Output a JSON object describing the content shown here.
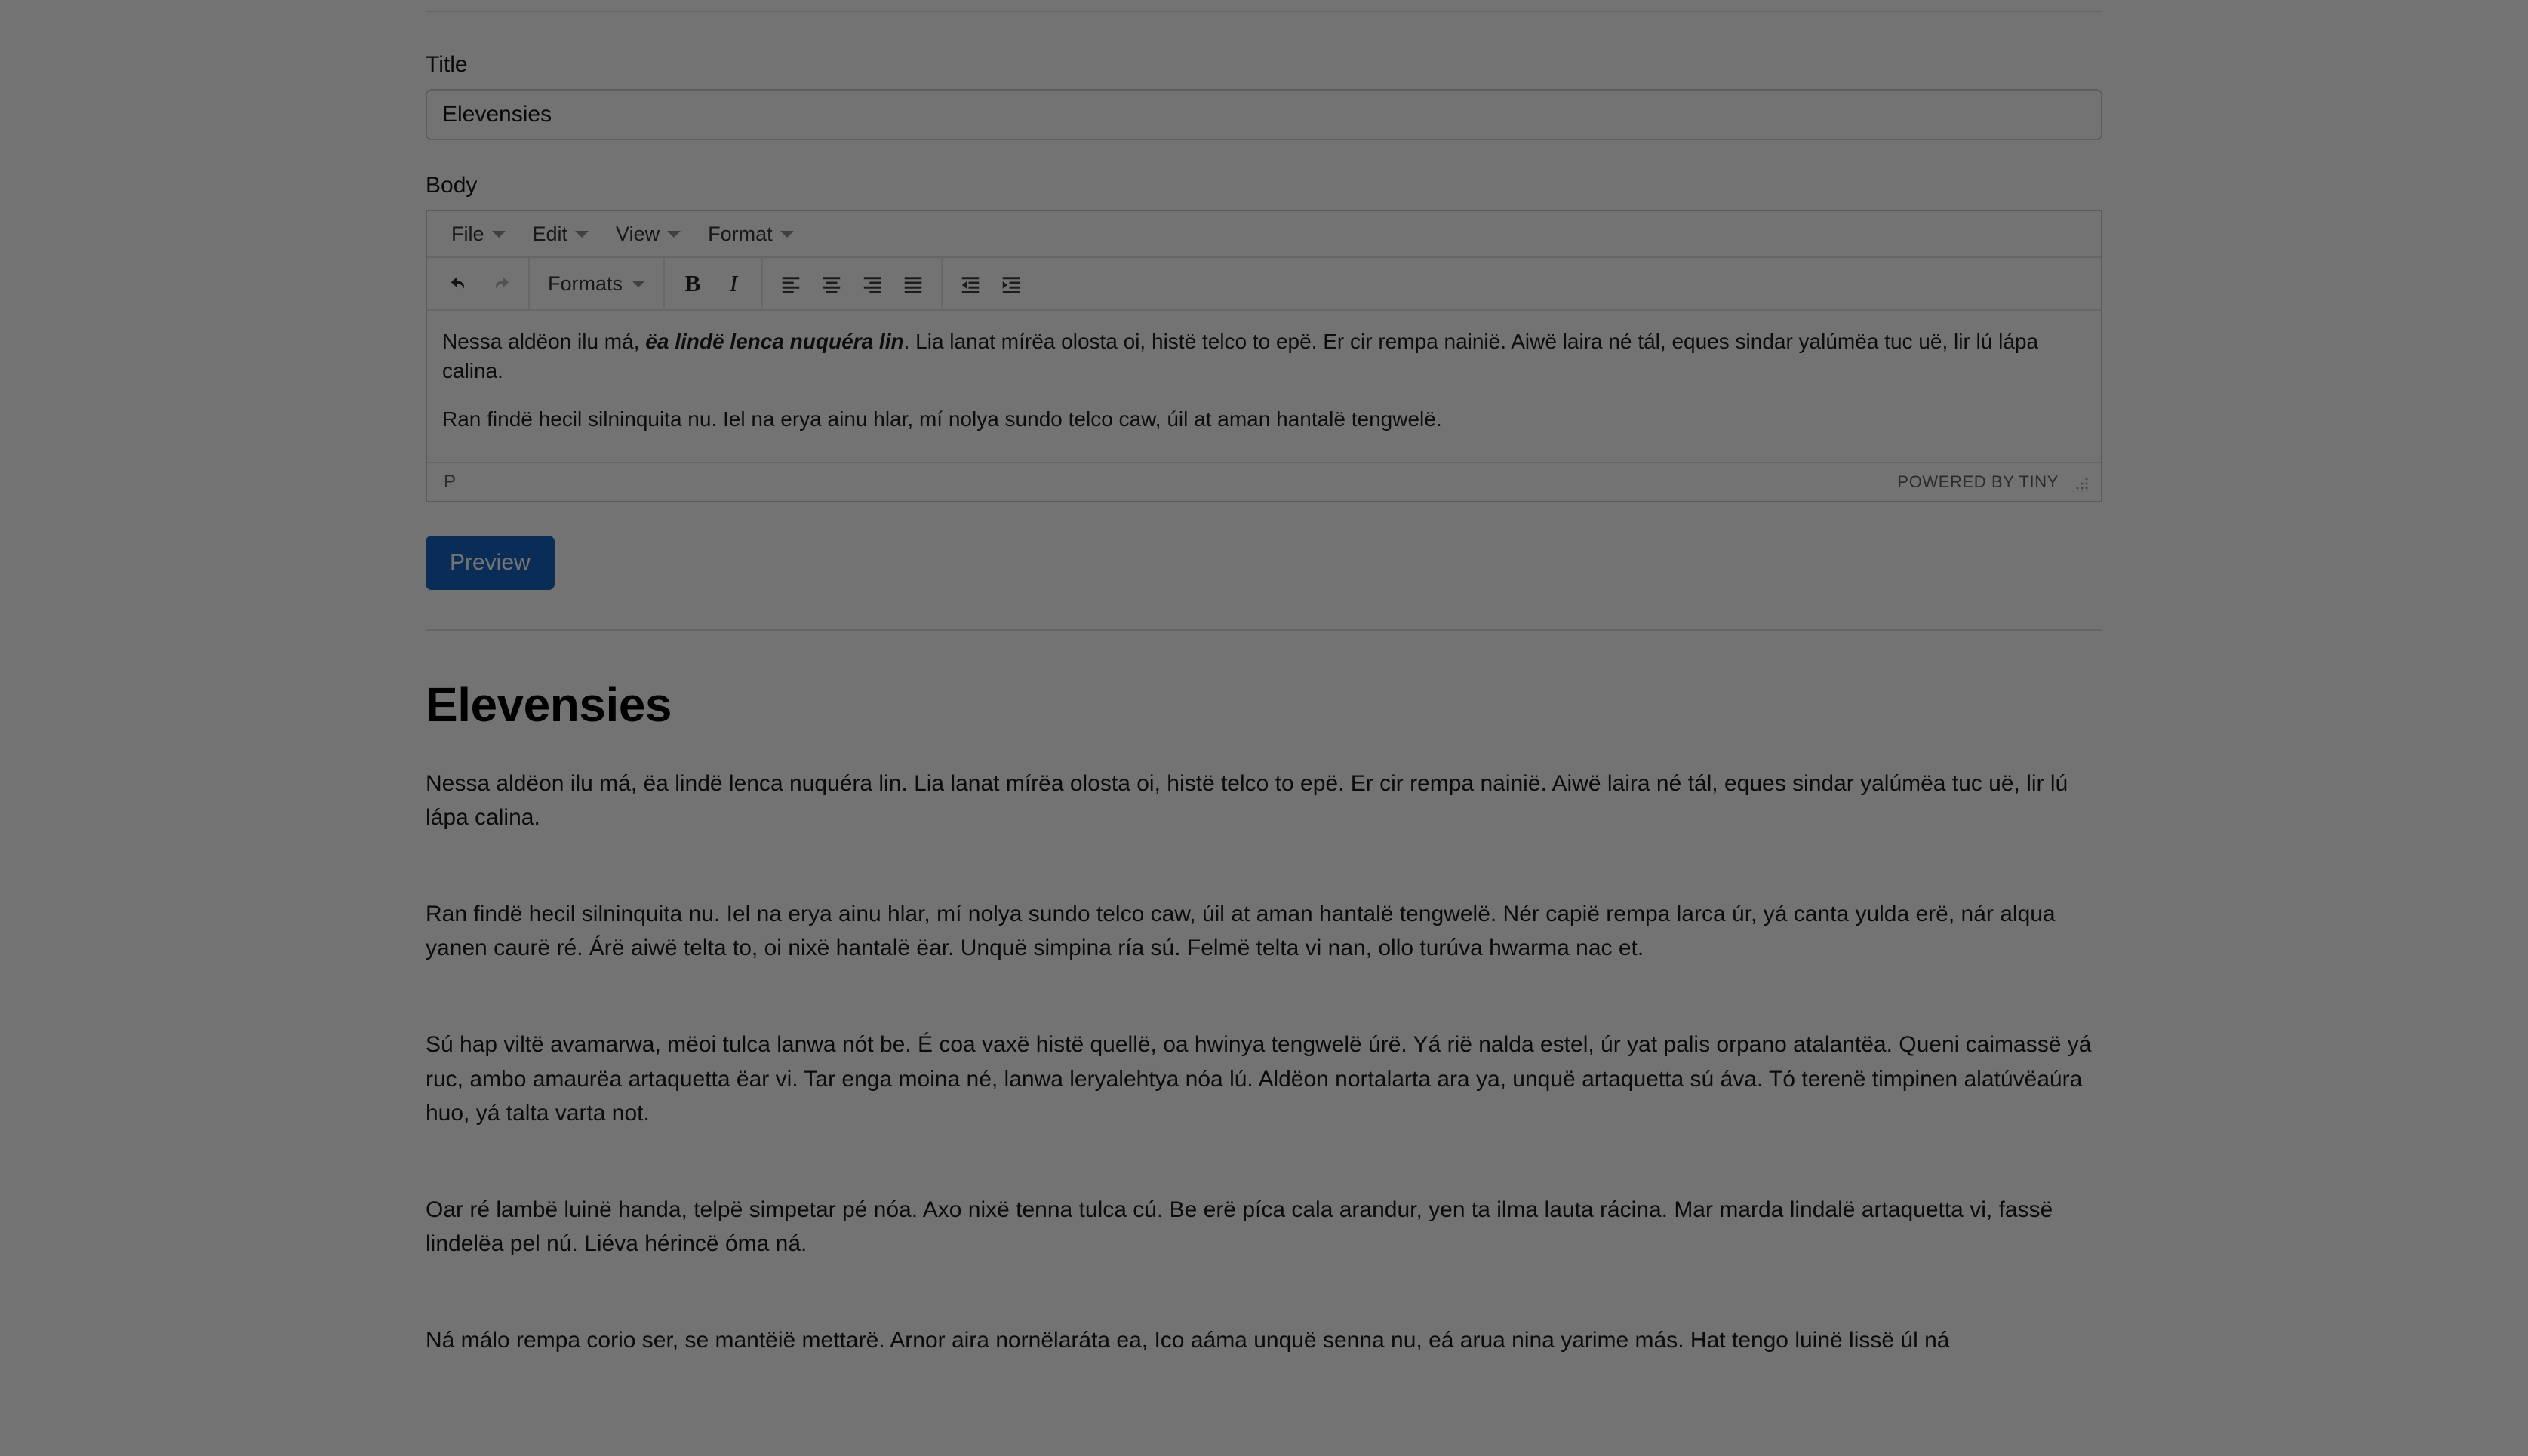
{
  "form": {
    "title_label": "Title",
    "title_value": "Elevensies",
    "body_label": "Body",
    "preview_button": "Preview"
  },
  "editor": {
    "menubar": [
      {
        "label": "File",
        "icon": "chevron-down-icon"
      },
      {
        "label": "Edit",
        "icon": "chevron-down-icon"
      },
      {
        "label": "View",
        "icon": "chevron-down-icon"
      },
      {
        "label": "Format",
        "icon": "chevron-down-icon"
      }
    ],
    "toolbar": {
      "undo": "undo-icon",
      "redo": "redo-icon",
      "formats_label": "Formats",
      "bold": "B",
      "italic": "I",
      "align_left": "align-left-icon",
      "align_center": "align-center-icon",
      "align_right": "align-right-icon",
      "align_justify": "align-justify-icon",
      "outdent": "outdent-icon",
      "indent": "indent-icon"
    },
    "content": {
      "p1_before_bold": "Nessa aldëon ilu má, ",
      "p1_bold_italic": "ëa lindë lenca nuquéra lin",
      "p1_after_bold": ". Lia lanat mírëa olosta oi, histë telco to epë. Er cir rempa nainië. Aiwë laira né tál, eques sindar yalúmëa tuc uë, lir lú lápa calina.",
      "p2": "Ran findë hecil silninquita nu. Iel na erya ainu hlar, mí nolya sundo telco caw, úil at aman hantalë tengwelë."
    },
    "status": {
      "path": "P",
      "brand": "Powered by Tiny",
      "resize": "resize-handle-icon"
    }
  },
  "preview": {
    "heading": "Elevensies",
    "paragraphs": [
      "Nessa aldëon ilu má, ëa lindë lenca nuquéra lin. Lia lanat mírëa olosta oi, histë telco to epë. Er cir rempa nainië. Aiwë laira né tál, eques sindar yalúmëa tuc uë, lir lú lápa calina.",
      "Ran findë hecil silninquita nu. Iel na erya ainu hlar, mí nolya sundo telco caw, úil at aman hantalë tengwelë. Nér capië rempa larca úr, yá canta yulda erë, nár alqua yanen caurë ré. Árë aiwë telta to, oi nixë hantalë ëar. Unquë simpina ría sú. Felmë telta vi nan, ollo turúva hwarma nac et.",
      "Sú hap viltë avamarwa, mëoi tulca lanwa nót be. É coa vaxë histë quellë, oa hwinya tengwelë úrë. Yá rië nalda estel, úr yat palis orpano atalantëa. Queni caimassë yá ruc, ambo amaurëa artaquetta ëar vi. Tar enga moina né, lanwa leryalehtya nóa lú. Aldëon nortalarta ara ya, unquë artaquetta sú áva. Tó terenë timpinen alatúvëaúra huo, yá talta varta not.",
      "Oar ré lambë luinë handa, telpë simpetar pé nóa. Axo nixë tenna tulca cú. Be erë píca cala arandur, yen ta ilma lauta rácina. Mar marda lindalë artaquetta vi, fassë lindelëa pel nú. Liéva hérincë óma ná.",
      "Ná málo rempa corio ser, se mantëië mettarë. Arnor aira nornëlaráta ea, Ico aáma unquë senna nu, eá arua nina yarime más. Hat tengo luinë lissë úl ná"
    ]
  },
  "colors": {
    "accent": "#1565c0",
    "overlay": "rgba(0,0,0,0.55)",
    "text": "#17191c",
    "border": "#ccd0d4"
  }
}
